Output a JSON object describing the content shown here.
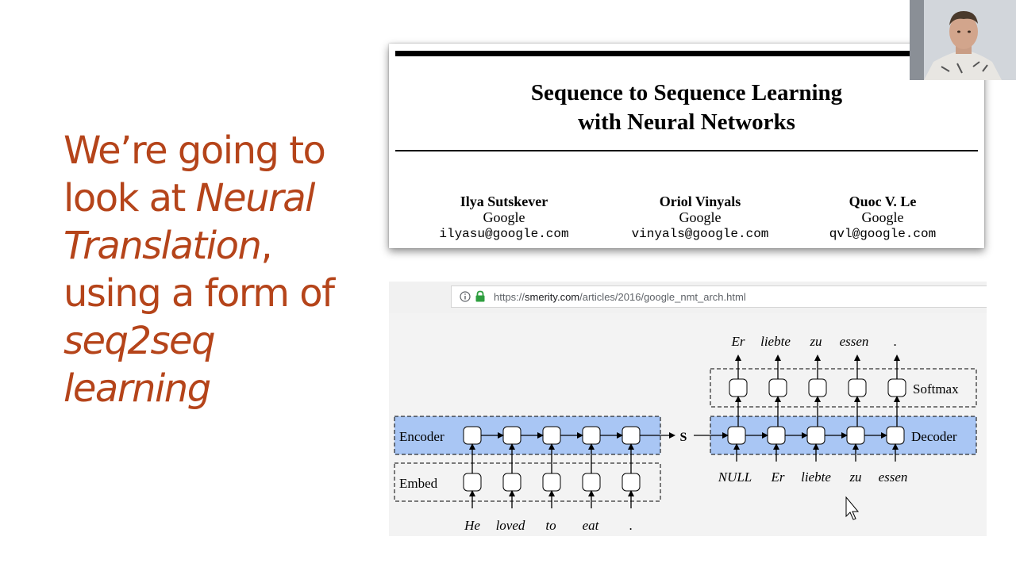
{
  "slide": {
    "line1": "We’re going to",
    "line2_plain": "look at ",
    "line2_italic": "Neural",
    "line3_italic": "Translation",
    "line3_plain": ",",
    "line4": "using a form of",
    "line5_italic": "seq2seq",
    "line6_italic": "learning"
  },
  "paper": {
    "title_line1": "Sequence to Sequence Learning",
    "title_line2": "with Neural Networks",
    "authors": [
      {
        "name": "Ilya Sutskever",
        "affiliation": "Google",
        "email": "ilyasu@google.com"
      },
      {
        "name": "Oriol Vinyals",
        "affiliation": "Google",
        "email": "vinyals@google.com"
      },
      {
        "name": "Quoc V. Le",
        "affiliation": "Google",
        "email": "qvl@google.com"
      }
    ]
  },
  "browser": {
    "url_prefix": "https://",
    "url_domain": "smerity.com",
    "url_path": "/articles/2016/google_nmt_arch.html",
    "info_icon": "info-icon",
    "lock_icon": "lock-icon",
    "lock_color": "#2e9e3f"
  },
  "diagram": {
    "encoder_label": "Encoder",
    "embed_label": "Embed",
    "state_label": "S",
    "decoder_label": "Decoder",
    "softmax_label": "Softmax",
    "input_words": [
      "He",
      "loved",
      "to",
      "eat",
      "."
    ],
    "decoder_inputs": [
      "NULL",
      "Er",
      "liebte",
      "zu",
      "essen"
    ],
    "output_words": [
      "Er",
      "liebte",
      "zu",
      "essen",
      "."
    ],
    "band_color": "#a9c6f4"
  }
}
